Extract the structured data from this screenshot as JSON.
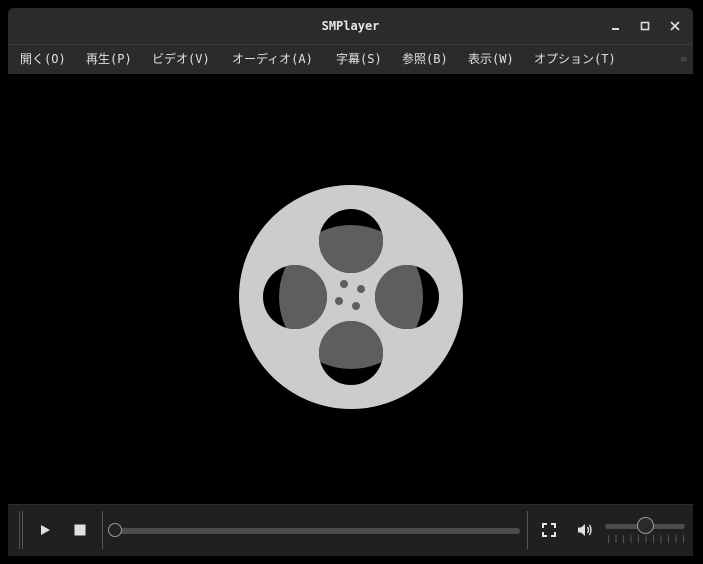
{
  "window": {
    "title": "SMPlayer"
  },
  "menu": {
    "items": [
      {
        "label": "開く(O)"
      },
      {
        "label": "再生(P)"
      },
      {
        "label": "ビデオ(V)"
      },
      {
        "label": "オーディオ(A)"
      },
      {
        "label": "字幕(S)"
      },
      {
        "label": "参照(B)"
      },
      {
        "label": "表示(W)"
      },
      {
        "label": "オプション(T)"
      }
    ],
    "extension_glyph": "»"
  },
  "icons": {
    "window_minimize": "minimize-icon",
    "window_maximize": "maximize-icon",
    "window_close": "close-icon",
    "logo": "film-reel-icon",
    "play": "play-icon",
    "stop": "stop-icon",
    "fullscreen": "fullscreen-icon",
    "volume": "speaker-icon"
  },
  "playback": {
    "seek_position": 0.0,
    "volume_level": 0.5
  },
  "colors": {
    "titlebar": "#2b2b2b",
    "control_bar": "#202020",
    "video_background": "#000000",
    "reel_light": "#cccccc",
    "reel_dark": "#5e5e5e"
  }
}
